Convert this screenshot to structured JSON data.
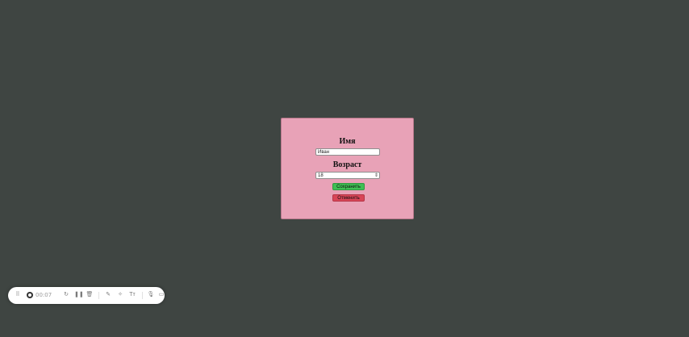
{
  "form": {
    "name_label": "Имя",
    "name_value": "Иван",
    "age_label": "Возраст",
    "age_value": "18",
    "save_label": "Сохранить",
    "cancel_label": "Отменить"
  },
  "colors": {
    "page_background": "#3f4542",
    "dialog_background": "#e8a2b7",
    "save_button": "#3fbf54",
    "cancel_button": "#d84557"
  },
  "recorder": {
    "timer": "00:07",
    "icons": [
      "drag-handle-icon",
      "record-icon",
      "restart-icon",
      "pause-icon",
      "delete-icon",
      "pen-icon",
      "effects-icon",
      "text-icon",
      "microphone-icon",
      "camera-icon"
    ]
  }
}
